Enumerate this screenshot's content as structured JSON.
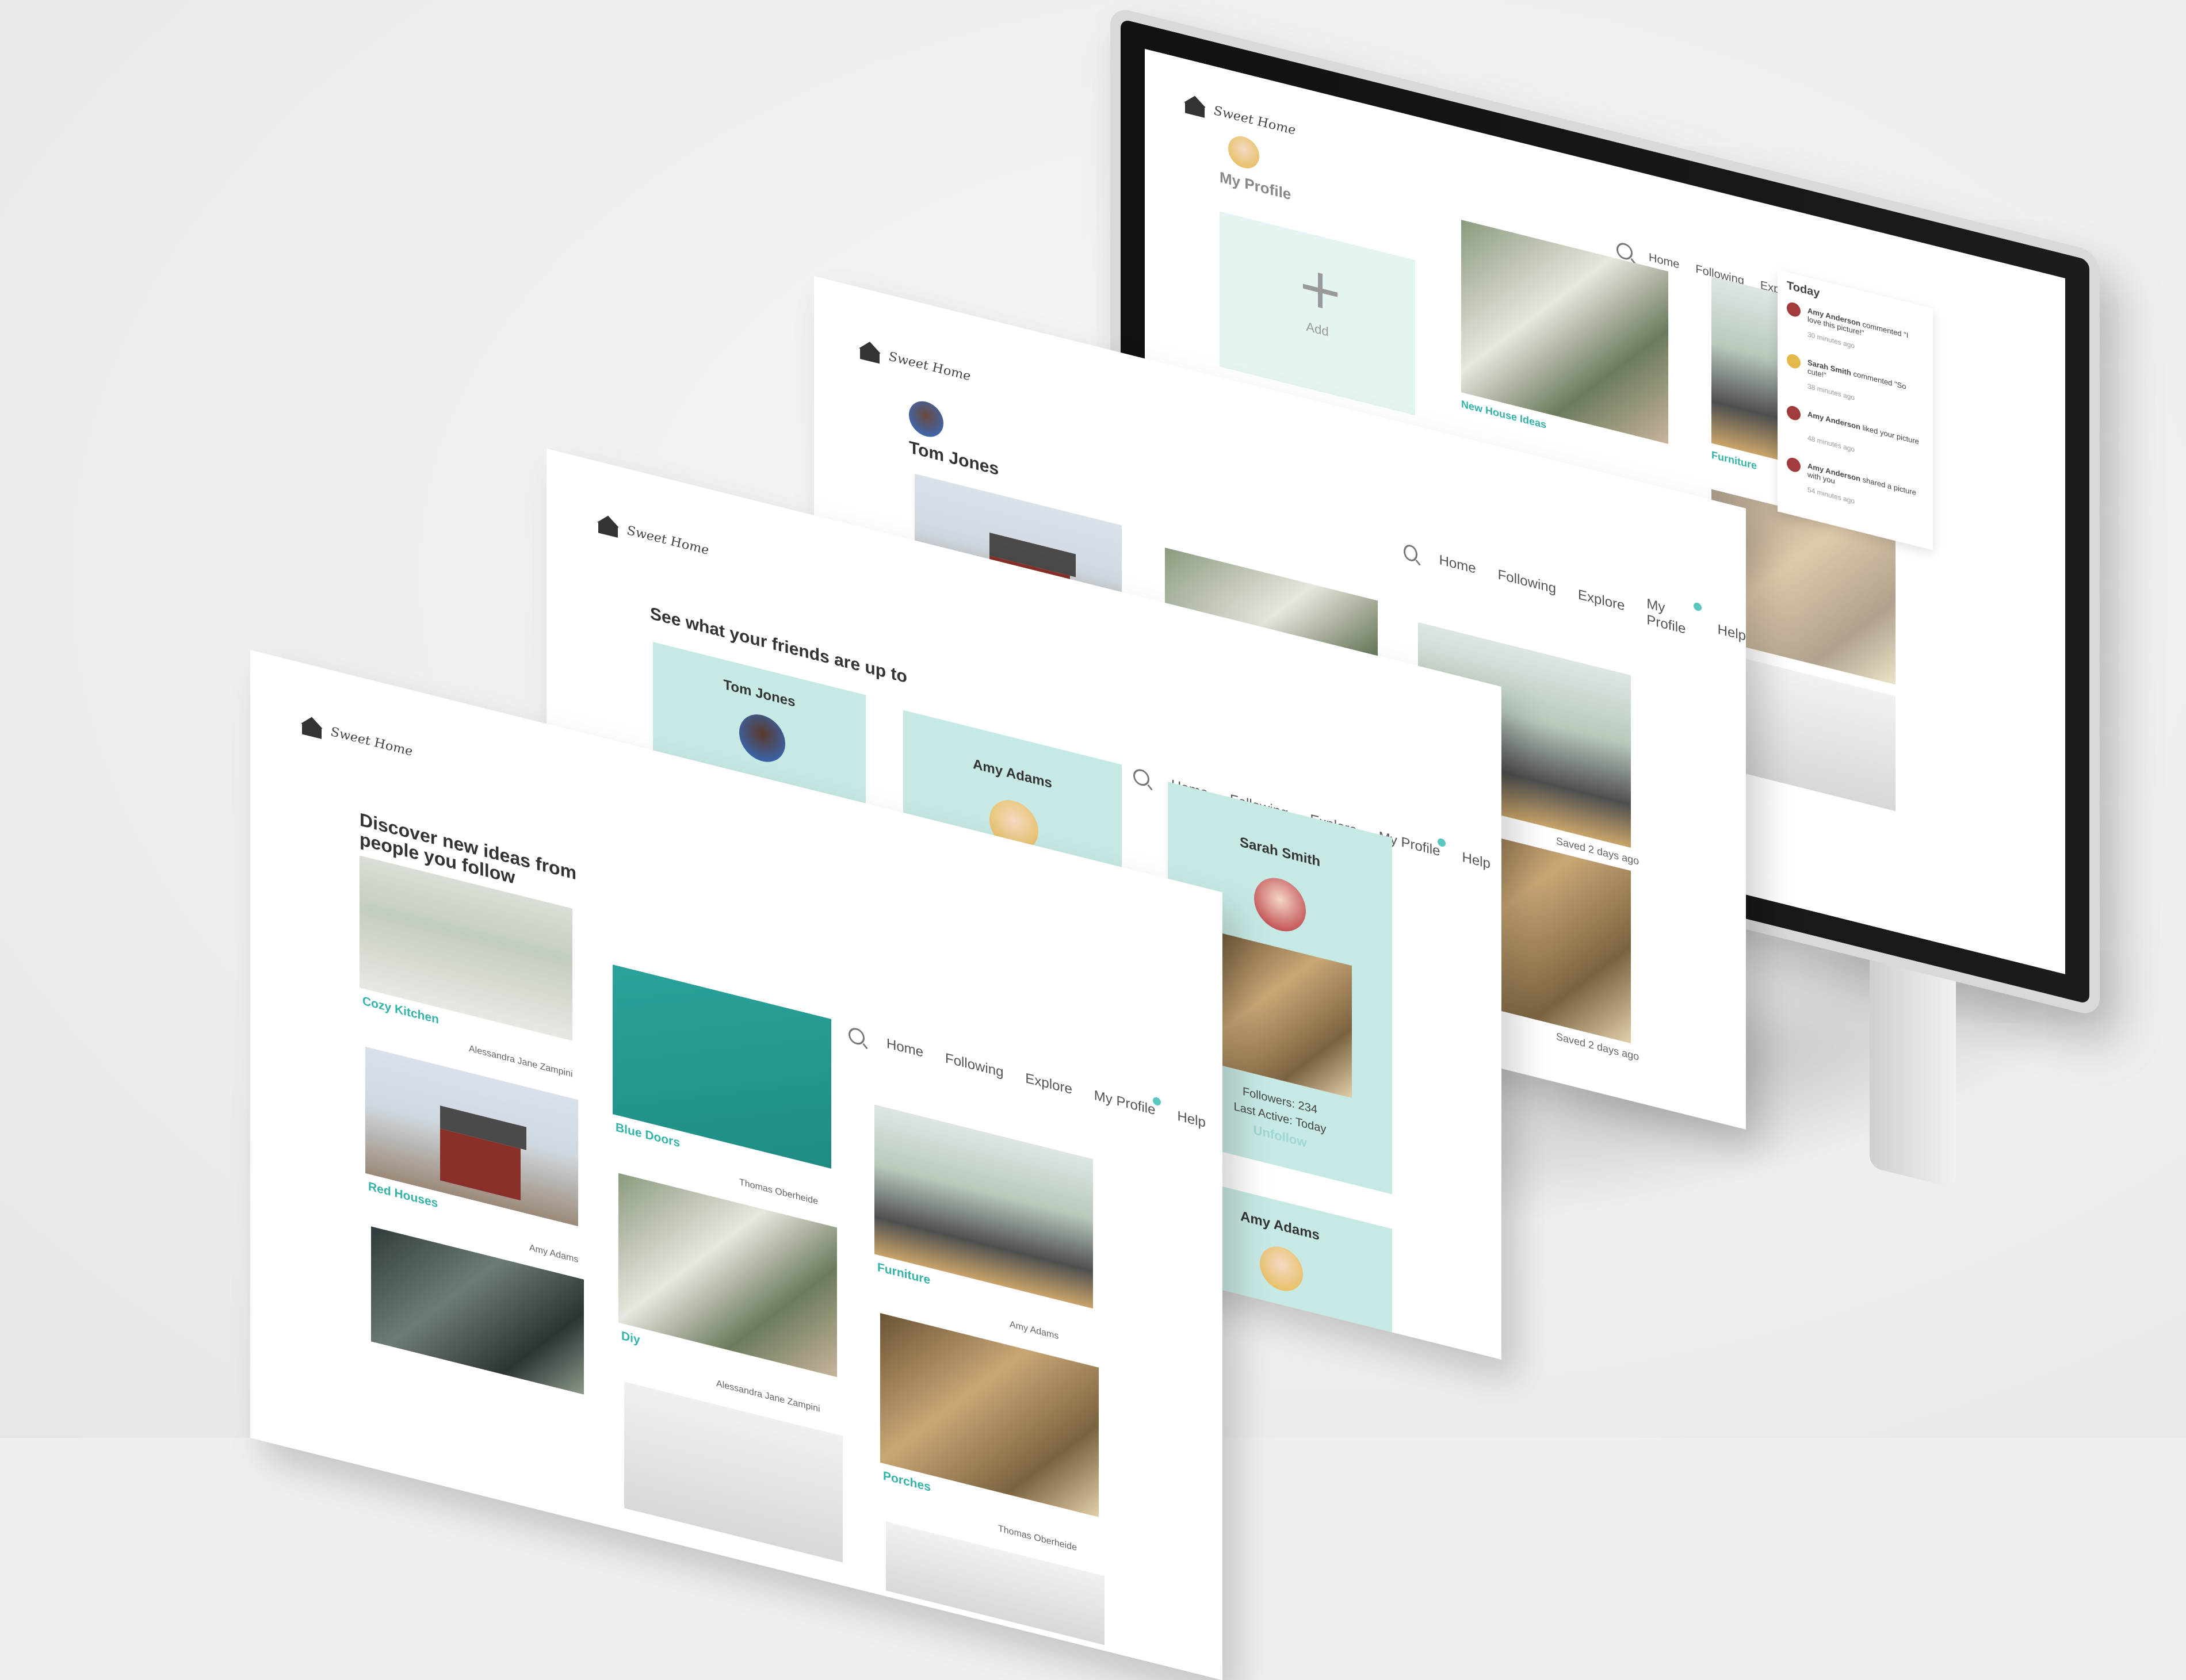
{
  "brand": "Sweet Home",
  "nav": {
    "home": "Home",
    "following": "Following",
    "explore": "Explore",
    "my_profile": "My Profile",
    "help": "Help"
  },
  "monitor": {
    "profile_title": "My Profile",
    "add_label": "Add",
    "tile_new_house": "New House Ideas",
    "tile_furniture": "Furniture",
    "notifications": {
      "heading": "Today",
      "items": [
        {
          "user": "Amy Anderson",
          "text": "commented \"I love this picture!\"",
          "time": "30 minutes ago"
        },
        {
          "user": "Sarah Smith",
          "text": "commented \"So cute!\"",
          "time": "38 minutes ago"
        },
        {
          "user": "Amy Anderson",
          "text": "liked your picture",
          "time": "48 minutes ago"
        },
        {
          "user": "Amy Anderson",
          "text": "shared a picture with you",
          "time": "54 minutes ago"
        }
      ]
    }
  },
  "panel_tom": {
    "title": "Tom Jones",
    "saved_1": "Saved 2 days ago",
    "saved_2": "Saved 2 days ago"
  },
  "panel_friends": {
    "heading": "See what your friends are up to",
    "friends": [
      {
        "name": "Tom Jones"
      },
      {
        "name": "Amy Adams"
      },
      {
        "name": "Sarah Smith",
        "followers": "Followers: 234",
        "last_active": "Last Active: Today",
        "unfollow": "Unfollow"
      },
      {
        "name": "Amy Adams"
      }
    ]
  },
  "panel_discover": {
    "heading": "Discover new ideas from people you follow",
    "cards": [
      {
        "caption": "Cozy Kitchen",
        "author": "Alessandra Jane Zampini"
      },
      {
        "caption": "Blue Doors",
        "author": "Thomas Oberheide"
      },
      {
        "caption": "Furniture",
        "author": "Amy Adams"
      },
      {
        "caption": "Red Houses",
        "author": "Amy Adams"
      },
      {
        "caption": "Diy",
        "author": "Alessandra Jane Zampini"
      },
      {
        "caption": "Porches",
        "author": "Thomas Oberheide"
      }
    ]
  },
  "colors": {
    "accent": "#34b3a8",
    "teal_card": "#c7e9e5",
    "badge": "#5cc8bd"
  }
}
